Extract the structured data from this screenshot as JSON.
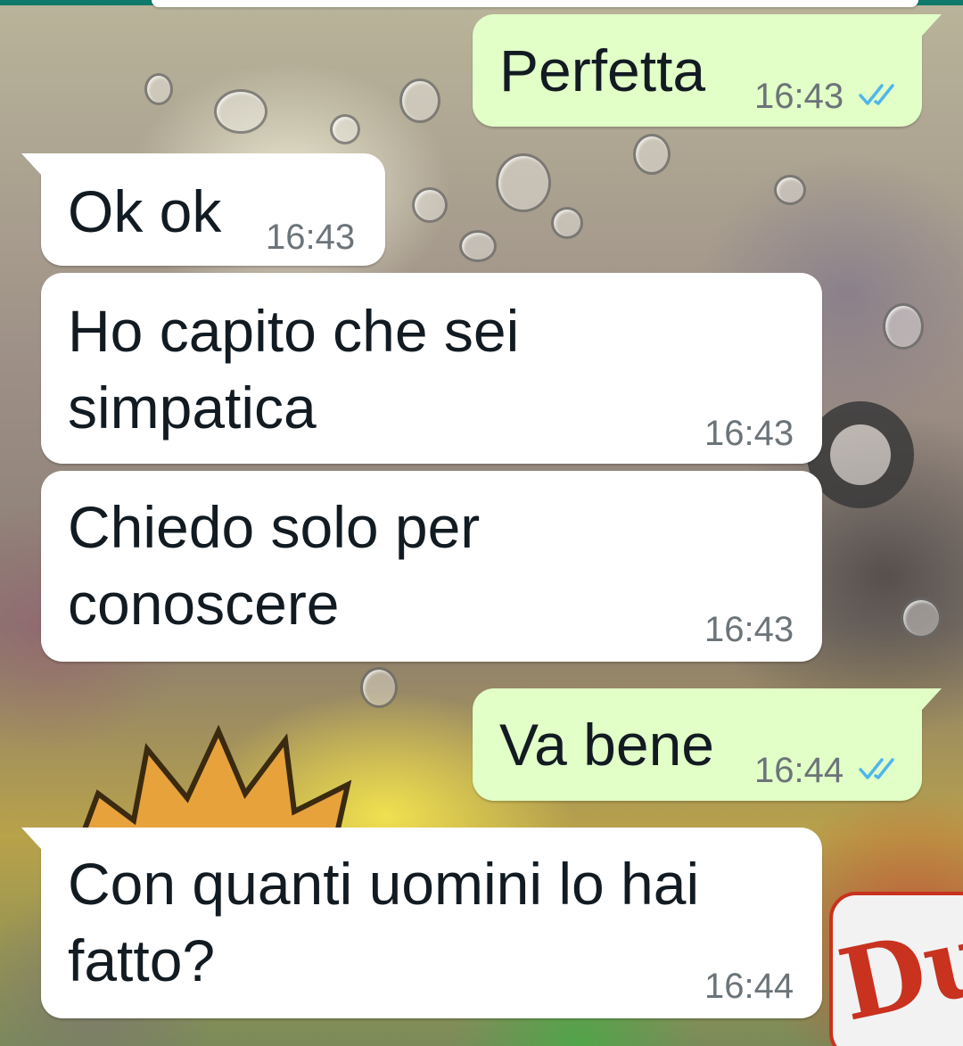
{
  "messages": [
    {
      "direction": "outgoing",
      "text": "Perfetta",
      "time": "16:43",
      "status": "read",
      "status_icon": "double-check-icon"
    },
    {
      "direction": "incoming",
      "text": "Ok ok",
      "time": "16:43"
    },
    {
      "direction": "incoming",
      "text": "Ho capito che sei\nsimpatica",
      "time": "16:43"
    },
    {
      "direction": "incoming",
      "text": "Chiedo solo per\nconoscere",
      "time": "16:43"
    },
    {
      "direction": "outgoing",
      "text": "Va bene",
      "time": "16:44",
      "status": "read",
      "status_icon": "double-check-icon"
    },
    {
      "direction": "incoming",
      "text": "Con quanti uomini lo hai\nfatto?",
      "time": "16:44"
    }
  ],
  "colors": {
    "incoming_bubble": "#ffffff",
    "outgoing_bubble": "#e1ffc7",
    "read_ticks": "#4fb6ec",
    "timestamp": "#6b7479",
    "header_accent": "#0f7a6b"
  }
}
